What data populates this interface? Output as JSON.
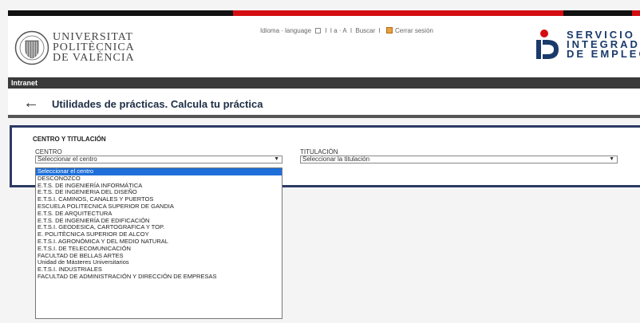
{
  "header": {
    "university_lines": [
      "UNIVERSITAT",
      "POLITÈCNICA",
      "DE VALÈNCIA"
    ],
    "toolbar": {
      "language": "Idioma · language",
      "font_size": "I a · A",
      "search": "Buscar",
      "logout": "Cerrar sesión"
    },
    "sie_lines": [
      "SERVICIO",
      "INTEGRADO",
      "DE EMPLEO"
    ]
  },
  "intranet_label": "Intranet",
  "page": {
    "title": "Utilidades de prácticas. Calcula tu práctica"
  },
  "form": {
    "section_title": "CENTRO Y TITULACIÓN",
    "centro_label": "CENTRO",
    "centro_value": "Seleccionar el centro",
    "titulacion_label": "TITULACIÓN",
    "titulacion_value": "Seleccionar la titulación",
    "centro_options": [
      "Seleccionar el centro",
      "DESCONOZCO",
      "E.T.S. DE INGENIERÍA INFORMÁTICA",
      "E.T.S. DE INGENIERIA DEL DISEÑO",
      "E.T.S.I. CAMINOS, CANALES Y PUERTOS",
      "ESCUELA POLITECNICA SUPERIOR DE GANDIA",
      "E.T.S. DE ARQUITECTURA",
      "E.T.S. DE INGENIERÍA DE EDIFICACIÓN",
      "E.T.S.I. GEODESICA, CARTOGRAFICA Y TOP.",
      "E. POLITÈCNICA SUPERIOR DE ALCOY",
      "E.T.S.I. AGRONÓMICA Y DEL MEDIO NATURAL",
      "E.T.S.I. DE TELECOMUNICACIÓN",
      "FACULTAD DE BELLAS ARTES",
      "Unidad de Másteres Universitarios",
      "E.T.S.I. INDUSTRIALES",
      "FACULTAD DE ADMINISTRACIÓN Y DIRECCIÓN DE EMPRESAS"
    ],
    "selected_option": 0
  },
  "colors": {
    "brand_red": "#d40d12",
    "panel_border": "#2c3a66",
    "selection_blue": "#1e6fd9"
  }
}
